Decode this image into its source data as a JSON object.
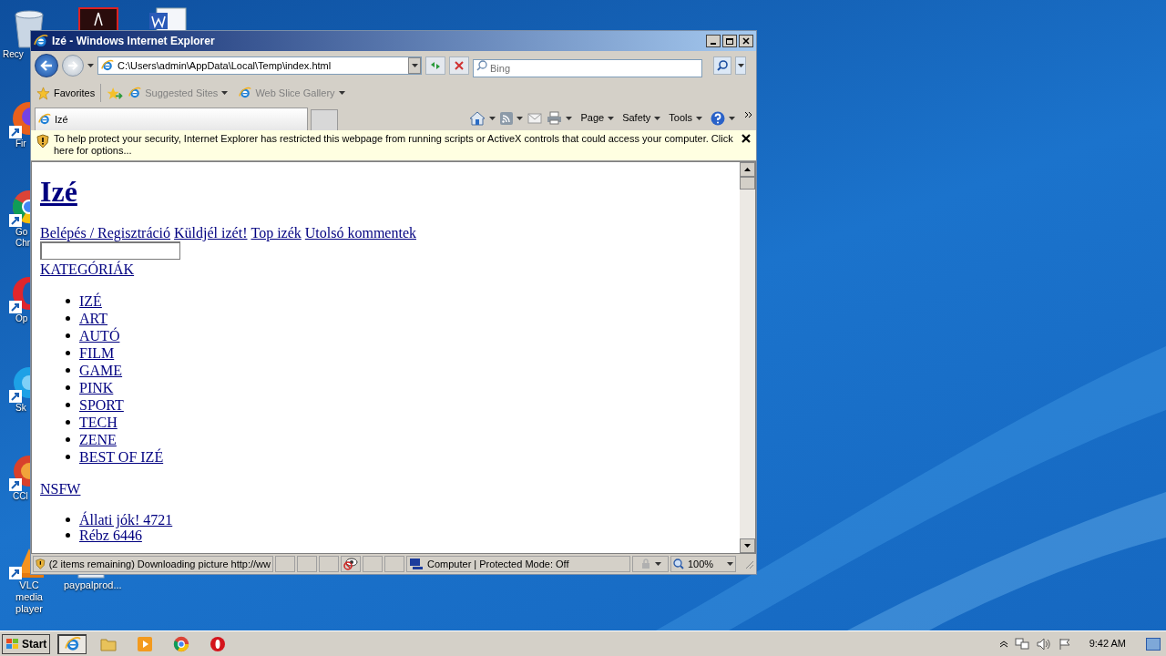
{
  "desktop": {
    "icons": [
      {
        "kind": "recycle",
        "label": "Recy"
      },
      {
        "kind": "acrobat"
      },
      {
        "kind": "word"
      },
      {
        "kind": "firefox",
        "label": "Fir"
      },
      {
        "kind": "chrome",
        "label": "Go Chr"
      },
      {
        "kind": "opera",
        "label": "Op"
      },
      {
        "kind": "skype",
        "label": "Sk"
      },
      {
        "kind": "ccleaner",
        "label": "CCl"
      },
      {
        "kind": "vlc",
        "label": "VLC media player"
      },
      {
        "kind": "file",
        "label": "paypalprod..."
      }
    ]
  },
  "window": {
    "title": "Izé - Windows Internet Explorer",
    "address": "C:\\Users\\admin\\AppData\\Local\\Temp\\index.html",
    "search_placeholder": "Bing",
    "favorites_bar": {
      "favorites": "Favorites",
      "links": [
        "Suggested Sites",
        "Web Slice Gallery"
      ]
    },
    "tabs": [
      {
        "title": "Izé",
        "selected": true
      }
    ],
    "command_bar": [
      "Page",
      "Safety",
      "Tools"
    ],
    "info_bar": "To help protect your security, Internet Explorer has restricted this webpage from running scripts or ActiveX controls that could access your computer. Click here for options...",
    "page": {
      "heading": "Izé",
      "nav": [
        "Belépés / Regisztráció",
        "Küldjél izét!",
        "Top izék",
        "Utolsó kommentek"
      ],
      "categories_heading": "KATEGÓRIÁK",
      "categories": [
        "IZÉ",
        "ART",
        "AUTÓ",
        "FILM",
        "GAME",
        "PINK",
        "SPORT",
        "TECH",
        "ZENE",
        "BEST OF IZÉ"
      ],
      "nsfw_heading": "NSFW",
      "nsfw": [
        "Állati jók! 4721",
        "Rébz 6446"
      ]
    },
    "status_bar": {
      "text": "(2 items remaining) Downloading picture http://ww",
      "zone": "Computer | Protected Mode: Off",
      "zoom": "100%"
    }
  },
  "taskbar": {
    "start": "Start",
    "apps": [
      {
        "kind": "ie",
        "selected": true
      },
      {
        "kind": "folder",
        "selected": false
      },
      {
        "kind": "media",
        "selected": false
      },
      {
        "kind": "chrome",
        "selected": false
      },
      {
        "kind": "opera",
        "selected": false
      }
    ],
    "clock": "9:42 AM"
  }
}
